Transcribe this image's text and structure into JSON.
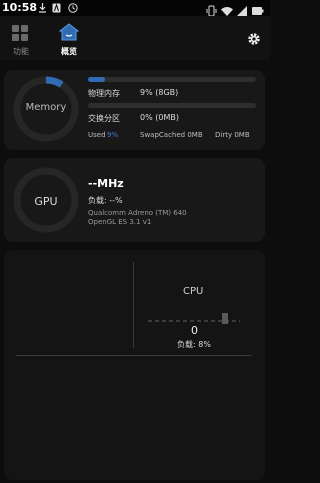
{
  "status_bar": {
    "time": "10:58"
  },
  "nav": {
    "tabs": [
      {
        "label": "功能"
      },
      {
        "label": "概览",
        "active": true
      }
    ]
  },
  "memory": {
    "ring_label": "Memory",
    "physical_label": "物理内存",
    "physical_value": "9% (8GB)",
    "physical_fraction": 0.09,
    "swap_label": "交换分区",
    "swap_value": "0% (0MB)",
    "swap_fraction": 0.0,
    "used_label": "Used",
    "used_value": "9%",
    "swapcached": "SwapCached 0MB",
    "dirty": "Dirty 0MB"
  },
  "gpu": {
    "ring_label": "GPU",
    "freq": "--MHz",
    "load": "负载: --%",
    "model": "Qualcomm Adreno (TM) 640",
    "api": "OpenGL ES 3.1 v1"
  },
  "cpu": {
    "label": "CPU",
    "value": "0",
    "load": "负载: 8%"
  },
  "colors": {
    "accent": "#2f6cb3",
    "card": "#181818",
    "bg": "#0d0d0d"
  }
}
